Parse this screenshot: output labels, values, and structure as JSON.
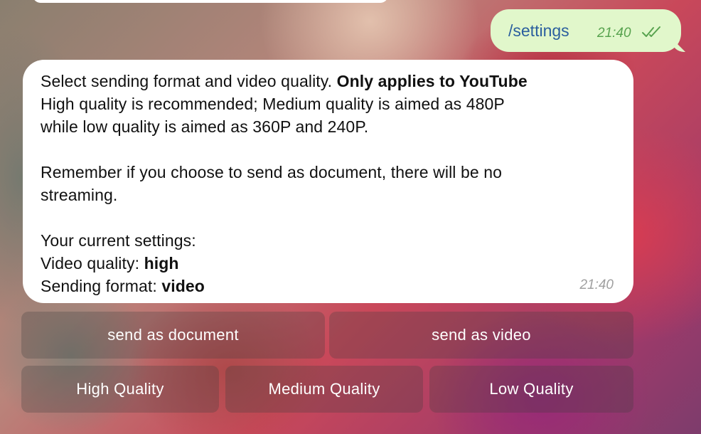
{
  "outgoing_message": {
    "text": "/settings",
    "time": "21:40"
  },
  "incoming_message": {
    "line1_regular": "Select sending format and video quality. ",
    "line1_bold": "Only applies to YouTube",
    "line2": "High quality is recommended; Medium quality is aimed as 480P",
    "line3": "while low quality is aimed as 360P and 240P.",
    "line4": "Remember if you choose to send as document, there will be no",
    "line5": "streaming.",
    "line6": "Your current settings:",
    "quality_label": "Video quality: ",
    "quality_value": "high",
    "format_label": "Sending format: ",
    "format_value": "video",
    "time": "21:40"
  },
  "keyboard": {
    "row1": [
      "send as document",
      "send as video"
    ],
    "row2": [
      "High Quality",
      "Medium Quality",
      "Low Quality"
    ]
  },
  "colors": {
    "outgoing_bubble": "#e1f7cb",
    "incoming_bubble": "#ffffff",
    "command_link": "#2b5f9e",
    "read_checks": "#58a34f"
  }
}
